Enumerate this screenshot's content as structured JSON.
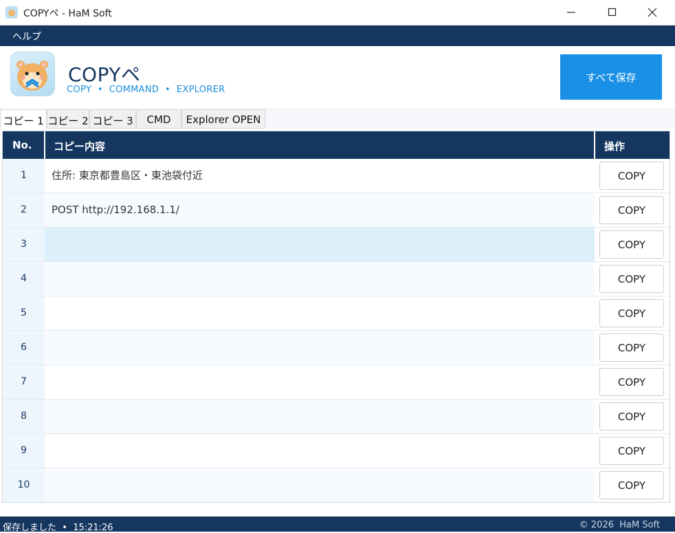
{
  "window": {
    "title": "COPYペ - HaM Soft"
  },
  "menu": {
    "help": "ヘルプ"
  },
  "header": {
    "brand_title": "COPYペ",
    "brand_sub": "COPY  •  COMMAND  •  EXPLORER",
    "save_all": "すべて保存"
  },
  "tabs": [
    {
      "label": "コピー 1",
      "active": true
    },
    {
      "label": "コピー 2"
    },
    {
      "label": "コピー 3"
    },
    {
      "label": "CMD"
    },
    {
      "label": "Explorer OPEN"
    }
  ],
  "grid": {
    "headers": {
      "no": "No.",
      "content": "コピー内容",
      "action": "操作"
    },
    "copy_label": "COPY",
    "rows": [
      {
        "no": "1",
        "content": "住所: 東京都豊島区・東池袋付近"
      },
      {
        "no": "2",
        "content": "POST http://192.168.1.1/"
      },
      {
        "no": "3",
        "content": ""
      },
      {
        "no": "4",
        "content": ""
      },
      {
        "no": "5",
        "content": ""
      },
      {
        "no": "6",
        "content": ""
      },
      {
        "no": "7",
        "content": ""
      },
      {
        "no": "8",
        "content": ""
      },
      {
        "no": "9",
        "content": ""
      },
      {
        "no": "10",
        "content": ""
      }
    ]
  },
  "status": {
    "left": "保存しました  •  15:21:26",
    "right": "© 2026  HaM Soft"
  },
  "colors": {
    "navy": "#14365f",
    "accent": "#1a8fe6",
    "selected_row": "#dcf0fc"
  }
}
